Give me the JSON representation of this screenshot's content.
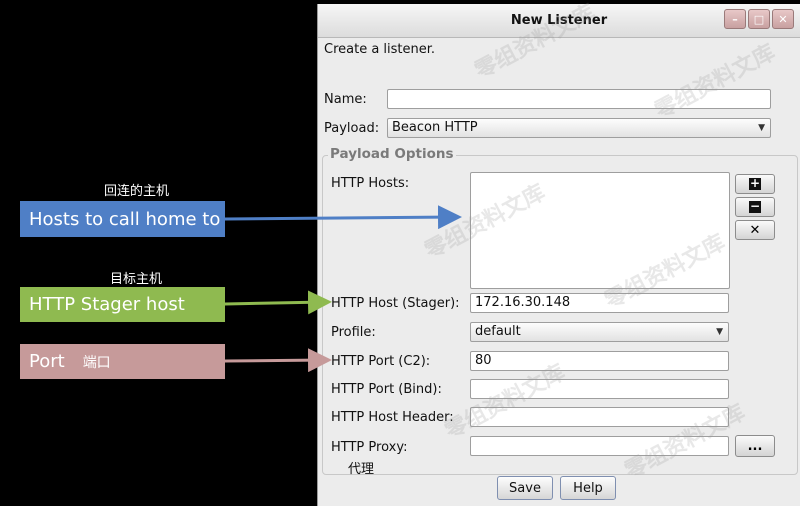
{
  "annotations": [
    {
      "caption": "回连的主机",
      "label": "Hosts to call home to",
      "sub": "",
      "color": "#4f7fc6"
    },
    {
      "caption": "目标主机",
      "label": "HTTP Stager host",
      "sub": "",
      "color": "#8fba50"
    },
    {
      "caption": "",
      "label": "Port",
      "sub": "端口",
      "color": "#c69a9a"
    }
  ],
  "proxy_note": "代理",
  "watermark": "零组资料文库",
  "window": {
    "title": "New Listener",
    "subtitle": "Create a listener.",
    "controls": [
      "minimize-icon",
      "maximize-icon",
      "close-icon"
    ]
  },
  "form": {
    "name_label": "Name:",
    "name_value": "",
    "payload_label": "Payload:",
    "payload_value": "Beacon HTTP",
    "group_title": "Payload Options",
    "hosts_label": "HTTP Hosts:",
    "host_stager_label": "HTTP Host (Stager):",
    "host_stager_value": "172.16.30.148",
    "profile_label": "Profile:",
    "profile_value": "default",
    "port_c2_label": "HTTP Port (C2):",
    "port_c2_value": "80",
    "port_bind_label": "HTTP Port (Bind):",
    "port_bind_value": "",
    "host_header_label": "HTTP Host Header:",
    "host_header_value": "",
    "proxy_label": "HTTP Proxy:",
    "proxy_value": "",
    "proxy_button": "...",
    "add_button": "+",
    "remove_button": "−",
    "clear_button": "✕"
  },
  "buttons": {
    "save": "Save",
    "help": "Help"
  }
}
